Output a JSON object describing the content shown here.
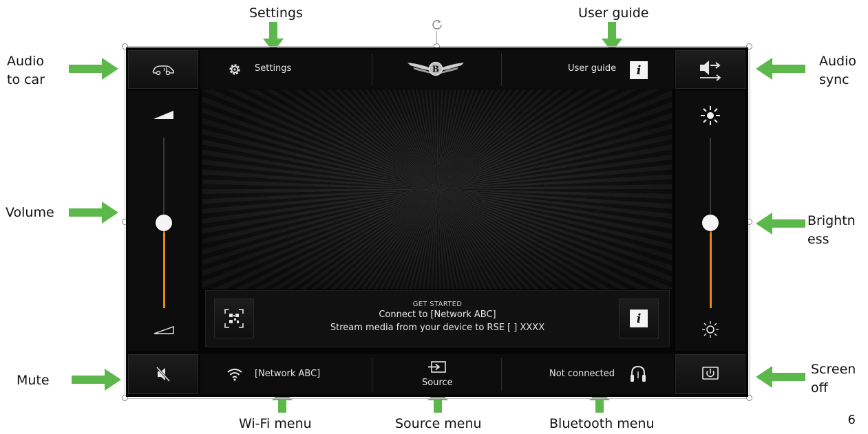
{
  "callouts": {
    "settings": "Settings",
    "user_guide": "User guide",
    "audio_to_car_1": "Audio",
    "audio_to_car_2": "to car",
    "audio_sync_1": "Audio",
    "audio_sync_2": "sync",
    "volume": "Volume",
    "brightness_1": "Brightn",
    "brightness_2": "ess",
    "mute": "Mute",
    "screen_off_1": "Screen",
    "screen_off_2": "off",
    "wifi_menu": "Wi-Fi menu",
    "source_menu": "Source menu",
    "bluetooth_menu": "Bluetooth menu"
  },
  "page_number": "6",
  "screen": {
    "top_bar": {
      "settings_label": "Settings",
      "user_guide_label": "User guide",
      "info_glyph": "i"
    },
    "banner": {
      "kicker": "GET STARTED",
      "line1": "Connect to [Network ABC]",
      "line2": "Stream media from your device to RSE [ ] XXXX",
      "info_glyph": "i"
    },
    "bottom_bar": {
      "wifi_label": "[Network ABC]",
      "source_label": "Source",
      "bluetooth_status": "Not connected"
    },
    "volume_level": 0.5,
    "brightness_level": 0.5
  },
  "colors": {
    "accent_slider": "#e8851b",
    "callout_arrow": "#5cb84a",
    "screen_bg": "#050505"
  },
  "icons": [
    "car-audio-icon",
    "gear-icon",
    "bentley-logo",
    "info-icon",
    "audio-sync-icon",
    "volume-high-icon",
    "volume-low-icon",
    "sun-bright-icon",
    "sun-dim-icon",
    "qr-code-icon",
    "mute-icon",
    "wifi-icon",
    "source-icon",
    "headphones-icon",
    "power-icon"
  ]
}
